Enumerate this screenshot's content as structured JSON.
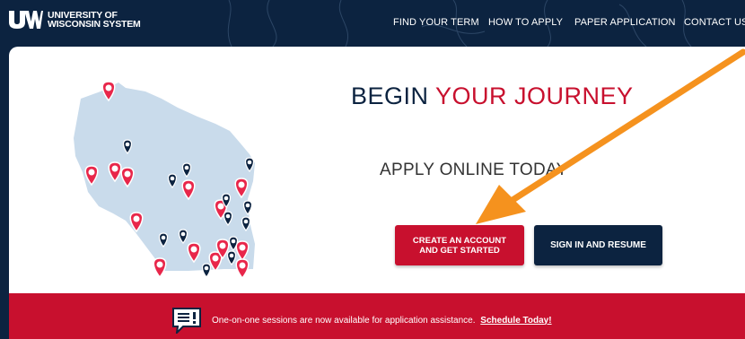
{
  "header": {
    "logo_line1": "UNIVERSITY OF",
    "logo_line2": "WISCONSIN SYSTEM",
    "nav": [
      {
        "label": "FIND YOUR TERM"
      },
      {
        "label": "HOW TO APPLY"
      },
      {
        "label": "PAPER APPLICATION"
      },
      {
        "label": "CONTACT US"
      }
    ]
  },
  "hero": {
    "headline_part1": "BEGIN",
    "headline_part2": "YOUR JOURNEY",
    "subheadline": "APPLY ONLINE TODAY",
    "create_button": "CREATE AN ACCOUNT AND GET STARTED",
    "signin_button": "SIGN IN AND RESUME"
  },
  "banner": {
    "text": "One-on-one sessions are now available for application assistance.",
    "link": "Schedule Today!",
    "icon": "chat-alert-icon"
  },
  "colors": {
    "navy": "#0c2340",
    "red": "#c8102e",
    "map_fill": "#c9dbeb",
    "arrow": "#f5921e"
  }
}
